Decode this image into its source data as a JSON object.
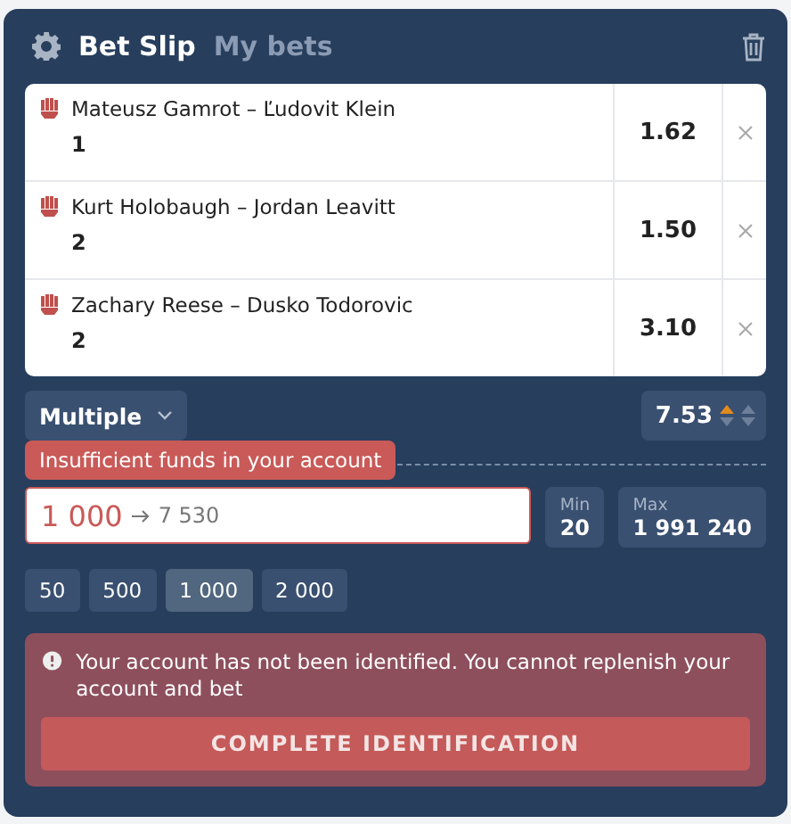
{
  "tabs": [
    {
      "label": "Bet Slip",
      "selected": true
    },
    {
      "label": "My bets",
      "selected": false
    }
  ],
  "bets": [
    {
      "event": "Mateusz Gamrot – Ľudovit Klein",
      "pick": "1",
      "odds": "1.62"
    },
    {
      "event": "Kurt Holobaugh – Jordan Leavitt",
      "pick": "2",
      "odds": "1.50"
    },
    {
      "event": "Zachary Reese – Dusko Todorovic",
      "pick": "2",
      "odds": "3.10"
    }
  ],
  "bet_type": "Multiple",
  "total_odds": {
    "value": "7.53",
    "rising": true
  },
  "error_tooltip": "Insufficient funds in your account",
  "stake": {
    "value": "1 000",
    "payout": "7 530"
  },
  "min": {
    "label": "Min",
    "value": "20"
  },
  "max": {
    "label": "Max",
    "value": "1 991 240"
  },
  "quick_stakes": [
    {
      "label": "50",
      "selected": false
    },
    {
      "label": "500",
      "selected": false
    },
    {
      "label": "1 000",
      "selected": true
    },
    {
      "label": "2 000",
      "selected": false
    }
  ],
  "alert": {
    "message": "Your account has not been identified. You cannot replenish your account and bet",
    "button": "COMPLETE IDENTIFICATION"
  }
}
